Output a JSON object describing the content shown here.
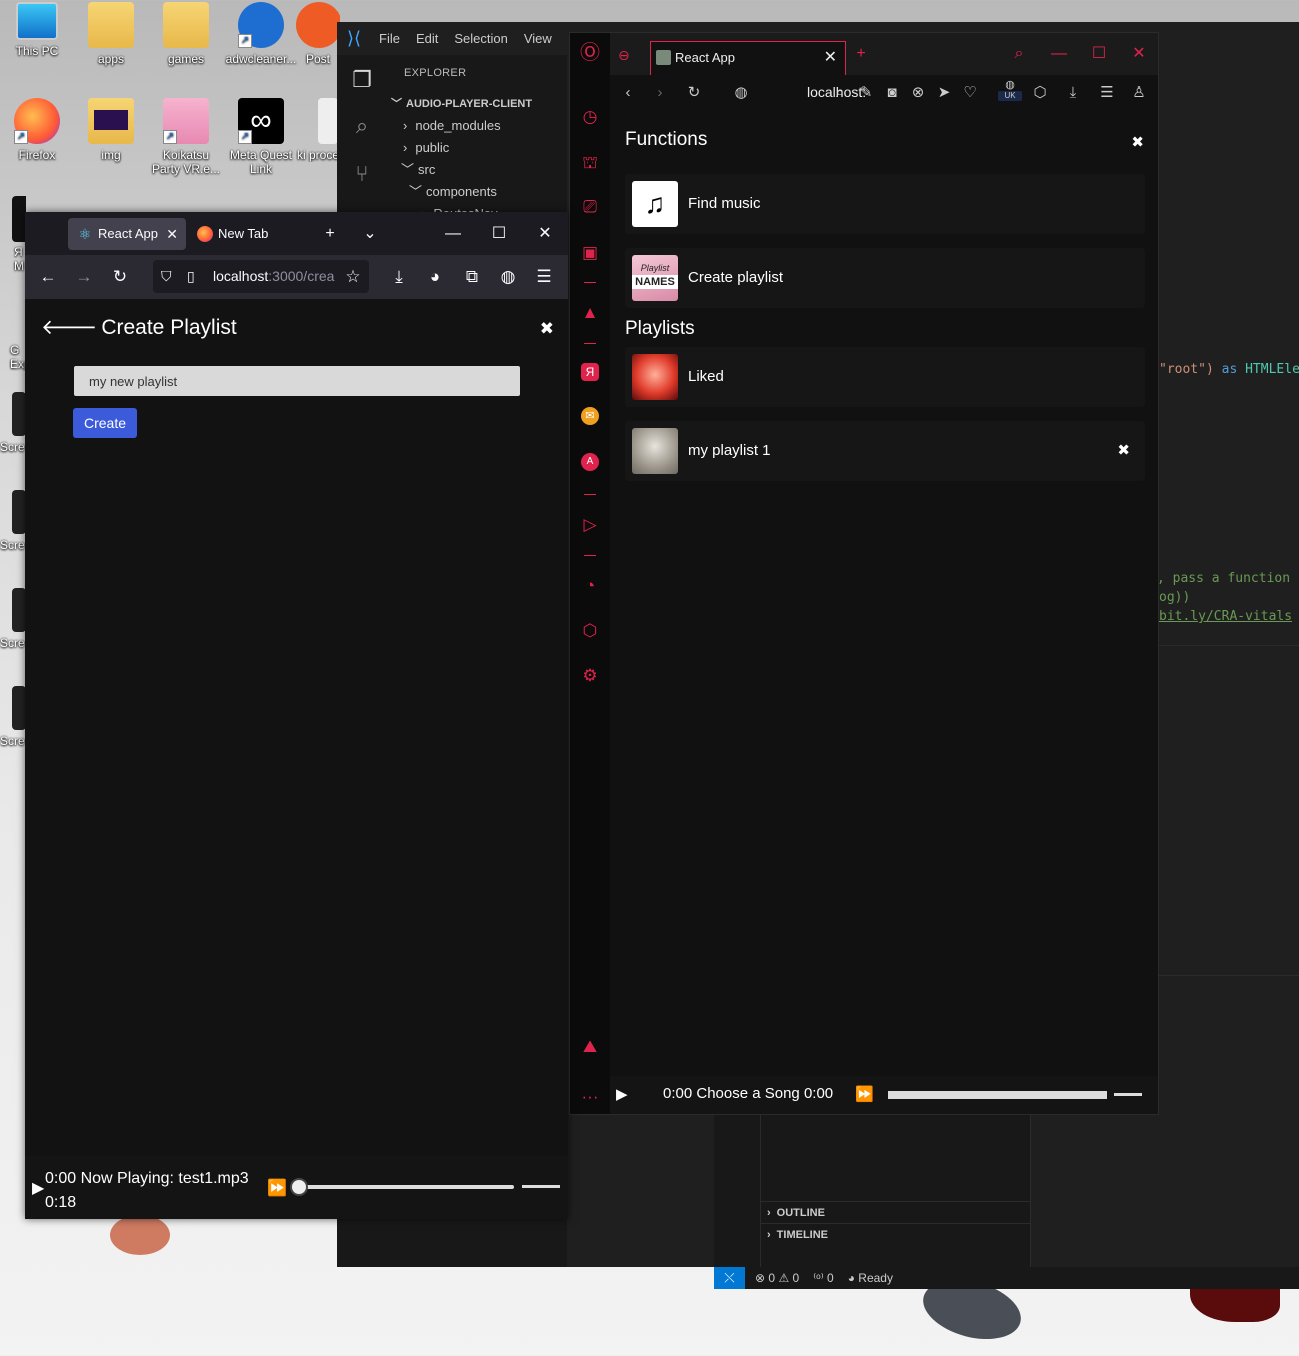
{
  "desktop": {
    "icons": [
      {
        "label": "This PC"
      },
      {
        "label": "apps"
      },
      {
        "label": "games"
      },
      {
        "label": "adwcleaner..."
      },
      {
        "label": "Post"
      },
      {
        "label": "Firefox"
      },
      {
        "label": "img"
      },
      {
        "label": "Koikatsu Party VR.e..."
      },
      {
        "label": "Meta Quest Link"
      },
      {
        "label": "ki proce"
      },
      {
        "label": "Я M"
      },
      {
        "label": "G Exp"
      },
      {
        "label": "Scre"
      },
      {
        "label": "Scre"
      },
      {
        "label": "Scre"
      },
      {
        "label": "Scre"
      }
    ]
  },
  "vscode": {
    "menu": [
      "File",
      "Edit",
      "Selection",
      "View"
    ],
    "explorer_header": "EXPLORER",
    "tree": [
      {
        "label": "AUDIO-PLAYER-CLIENT",
        "arrow": "﹀"
      },
      {
        "label": "node_modules",
        "arrow": "›"
      },
      {
        "label": "public",
        "arrow": "›"
      },
      {
        "label": "src",
        "arrow": "﹀"
      },
      {
        "label": "components",
        "arrow": "﹀"
      },
      {
        "label": "RoutesNav",
        "arrow": "›"
      }
    ],
    "code": {
      "line1_str": "\"root\")",
      "line1_kw": "as",
      "line1_type": "HTMLEle",
      "line2": ", pass a function",
      "line3": "og))",
      "line4": "bit.ly/CRA-vitals"
    },
    "panels": {
      "outline": "OUTLINE",
      "timeline": "TIMELINE"
    },
    "status": {
      "errors": "0",
      "warnings": "0",
      "ports": "0",
      "ready": "Ready"
    }
  },
  "firefox": {
    "tabs": [
      {
        "title": "React App",
        "active": true
      },
      {
        "title": "New Tab",
        "active": false
      }
    ],
    "url_host": "localhost",
    "url_path": ":3000/crea",
    "page": {
      "title": "Create Playlist",
      "input_value": "my new playlist",
      "create_button": "Create"
    },
    "player": {
      "line1": "0:00 Now Playing: test1.mp3",
      "line2": "0:18",
      "progress": 0
    }
  },
  "opera": {
    "tab_title": "React App",
    "url": "localhost:",
    "region_badge": "UK",
    "functions_title": "Functions",
    "functions": [
      {
        "label": "Find music"
      },
      {
        "label": "Create playlist",
        "thumb_text_1": "Playlist",
        "thumb_text_2": "NAMES"
      }
    ],
    "playlists_title": "Playlists",
    "playlists": [
      {
        "label": "Liked"
      },
      {
        "label": "my playlist 1"
      }
    ],
    "player": {
      "text": "0:00 Choose a Song 0:00"
    }
  },
  "colors": {
    "opera_accent": "#e0234c",
    "create_button": "#3b5bdb",
    "vscode_blue": "#0078d4"
  }
}
